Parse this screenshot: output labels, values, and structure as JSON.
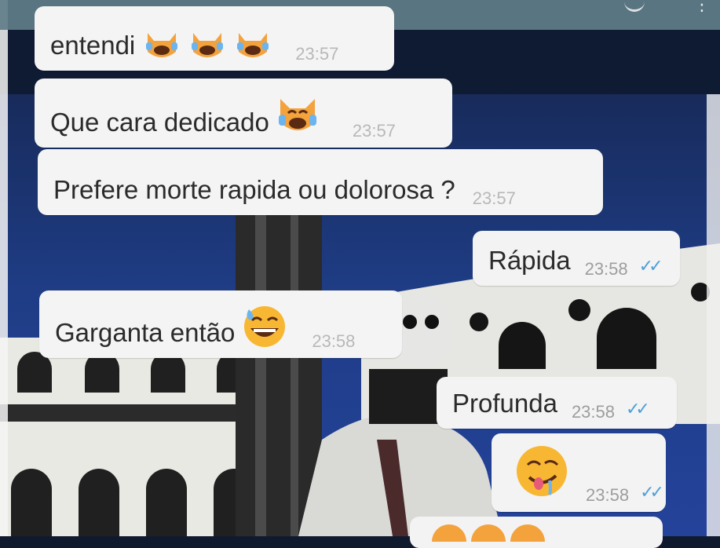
{
  "messages": [
    {
      "id": "m1",
      "direction": "incoming",
      "text": "entendi",
      "emojis": [
        "cat-tears-of-joy",
        "cat-tears-of-joy",
        "cat-tears-of-joy"
      ],
      "time": "23:57"
    },
    {
      "id": "m2",
      "direction": "incoming",
      "text": "Que cara dedicado",
      "emojis": [
        "cat-tears-of-joy"
      ],
      "time": "23:57"
    },
    {
      "id": "m3",
      "direction": "incoming",
      "text": "Prefere morte rapida ou dolorosa ?",
      "emojis": [],
      "time": "23:57"
    },
    {
      "id": "m4",
      "direction": "outgoing",
      "text": "Rápida",
      "emojis": [],
      "time": "23:58",
      "status": "read"
    },
    {
      "id": "m5",
      "direction": "incoming",
      "text": "Garganta então",
      "emojis": [
        "grinning-sweat"
      ],
      "time": "23:58"
    },
    {
      "id": "m6",
      "direction": "outgoing",
      "text": "Profunda",
      "emojis": [],
      "time": "23:58",
      "status": "read"
    },
    {
      "id": "m7",
      "direction": "outgoing",
      "text": "",
      "emojis": [
        "drooling-face"
      ],
      "time": "23:58",
      "status": "read"
    }
  ],
  "colors": {
    "bubble": "#f4f4f4",
    "text": "#2b2b2b",
    "time": "#b8b8b8",
    "read_ticks": "#4fa0d8",
    "wallpaper_blue": "#1f3f86"
  },
  "icons": {
    "read_receipt": "double-check-icon",
    "menu": "more-vert-icon"
  }
}
